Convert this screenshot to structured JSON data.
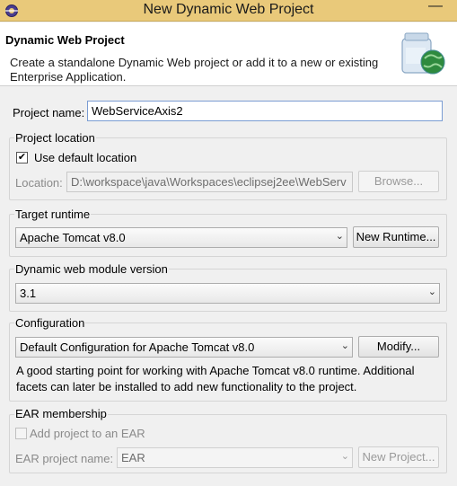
{
  "window": {
    "title": "New Dynamic Web Project",
    "minimize_glyph": "—"
  },
  "header": {
    "title": "Dynamic Web Project",
    "description": "Create a standalone Dynamic Web project or add it to a new or existing Enterprise Application."
  },
  "project_name": {
    "label": "Project name:",
    "value": "WebServiceAxis2"
  },
  "project_location": {
    "group_title": "Project location",
    "use_default_label": "Use default location",
    "use_default_checked": true,
    "location_label": "Location:",
    "location_value": "D:\\workspace\\java\\Workspaces\\eclipsej2ee\\WebServ",
    "browse_label": "Browse..."
  },
  "target_runtime": {
    "group_title": "Target runtime",
    "selected": "Apache Tomcat v8.0",
    "new_runtime_label": "New Runtime..."
  },
  "module_version": {
    "group_title": "Dynamic web module version",
    "selected": "3.1"
  },
  "configuration": {
    "group_title": "Configuration",
    "selected": "Default Configuration for Apache Tomcat v8.0",
    "modify_label": "Modify...",
    "description": "A good starting point for working with Apache Tomcat v8.0 runtime. Additional facets can later be installed to add new functionality to the project."
  },
  "ear_membership": {
    "group_title": "EAR membership",
    "add_to_ear_label": "Add project to an EAR",
    "add_to_ear_checked": false,
    "ear_project_label": "EAR project name:",
    "ear_project_value": "EAR",
    "new_project_label": "New Project..."
  },
  "icons": {
    "app": "eclipse-gear-icon",
    "banner": "web-project-jar-globe-icon",
    "check": "✔",
    "dropdown": "⌄"
  }
}
